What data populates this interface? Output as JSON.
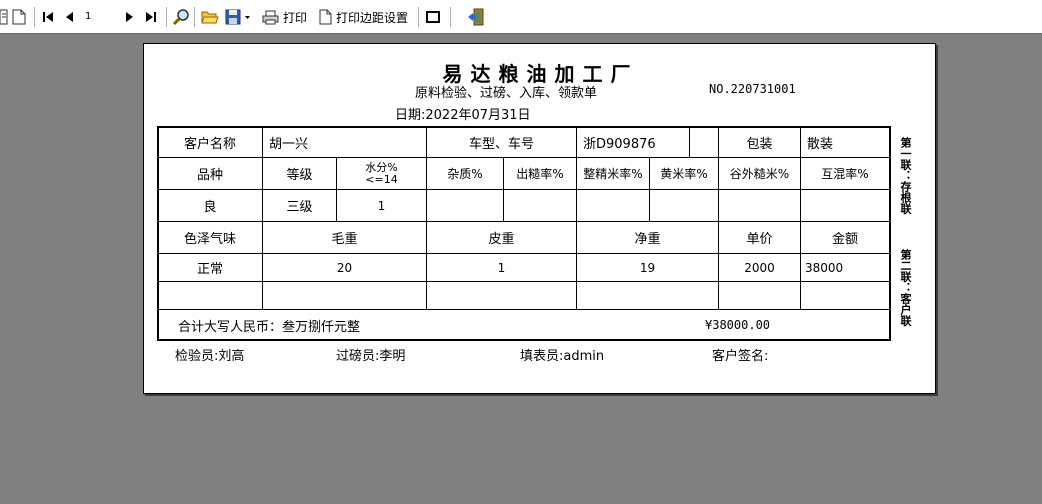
{
  "toolbar": {
    "page_number": "1",
    "print_label": "打印",
    "margin_label": "打印边距设置"
  },
  "report": {
    "title": "易达粮油加工厂",
    "subtitle": "原料检验、过磅、入库、领款单",
    "doc_no": "NO.220731001",
    "date": "日期:2022年07月31日",
    "customer_label": "客户名称",
    "customer_value": "胡一兴",
    "vehicle_label": "车型、车号",
    "vehicle_value": "浙D909876",
    "package_label": "包装",
    "package_value": "散装",
    "headers": {
      "variety": "品种",
      "grade": "等级",
      "moisture_line1": "水分%",
      "moisture_line2": "<=14",
      "impurity": "杂质%",
      "brown_rate": "出糙率%",
      "milled_rate": "整精米率%",
      "yellow_rate": "黄米率%",
      "foreign_rate": "谷外糙米%",
      "mixed_rate": "互混率%"
    },
    "quality_row": {
      "variety": "良",
      "grade": "三级",
      "moisture": "1"
    },
    "weight_headers": {
      "color": "色泽气味",
      "gross": "毛重",
      "tare": "皮重",
      "net": "净重",
      "price": "单价",
      "amount": "金额"
    },
    "weight_row": {
      "color": "正常",
      "gross": "20",
      "tare": "1",
      "net": "19",
      "price": "2000",
      "amount": "38000"
    },
    "total_label": "合计大写人民币：叁万捌仟元整",
    "total_amount": "¥38000.00",
    "side_copy1": "第一联：存根联",
    "side_copy2": "第二联：客户联",
    "inspector": "检验员:刘高",
    "weigher": "过磅员:李明",
    "filler": "填表员:admin",
    "signature": "客户签名:"
  }
}
